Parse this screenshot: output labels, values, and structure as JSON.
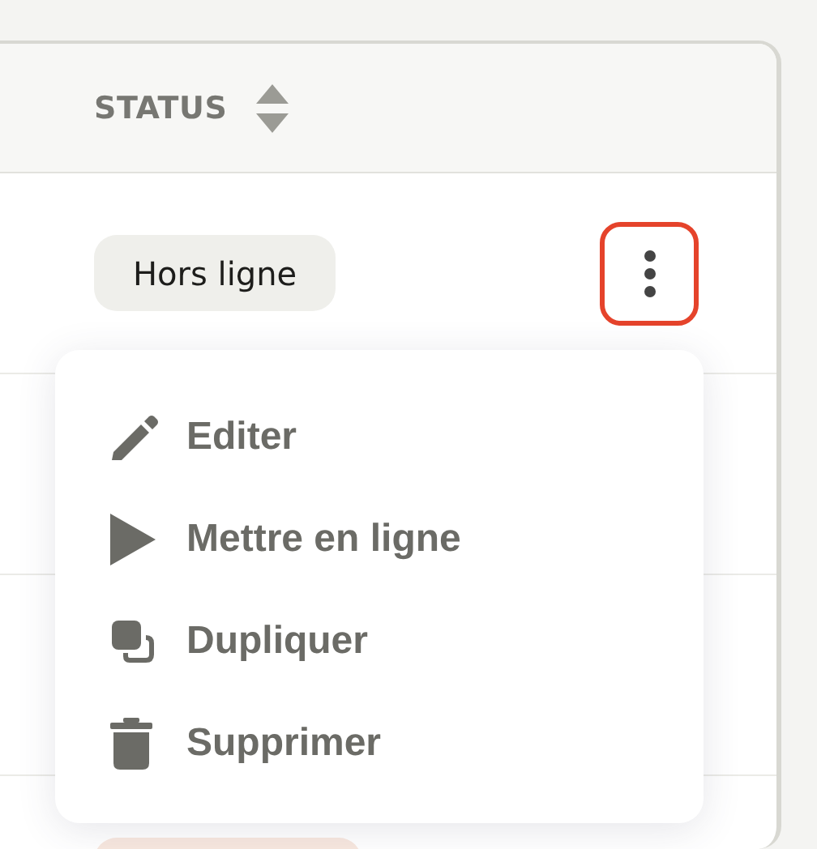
{
  "table": {
    "columns": [
      {
        "label": "STATUS",
        "sortable": true
      }
    ],
    "rows": [
      {
        "status": "Hors ligne",
        "color": "#efefeb",
        "actions": {
          "focused": true
        }
      },
      {},
      {},
      {
        "color": "#f8e8df"
      }
    ]
  },
  "menu": {
    "items": [
      {
        "kind": "edit",
        "label": "Editer"
      },
      {
        "kind": "publish",
        "label": "Mettre en ligne"
      },
      {
        "kind": "duplicate",
        "label": "Dupliquer"
      },
      {
        "kind": "delete",
        "label": "Supprimer"
      }
    ]
  }
}
